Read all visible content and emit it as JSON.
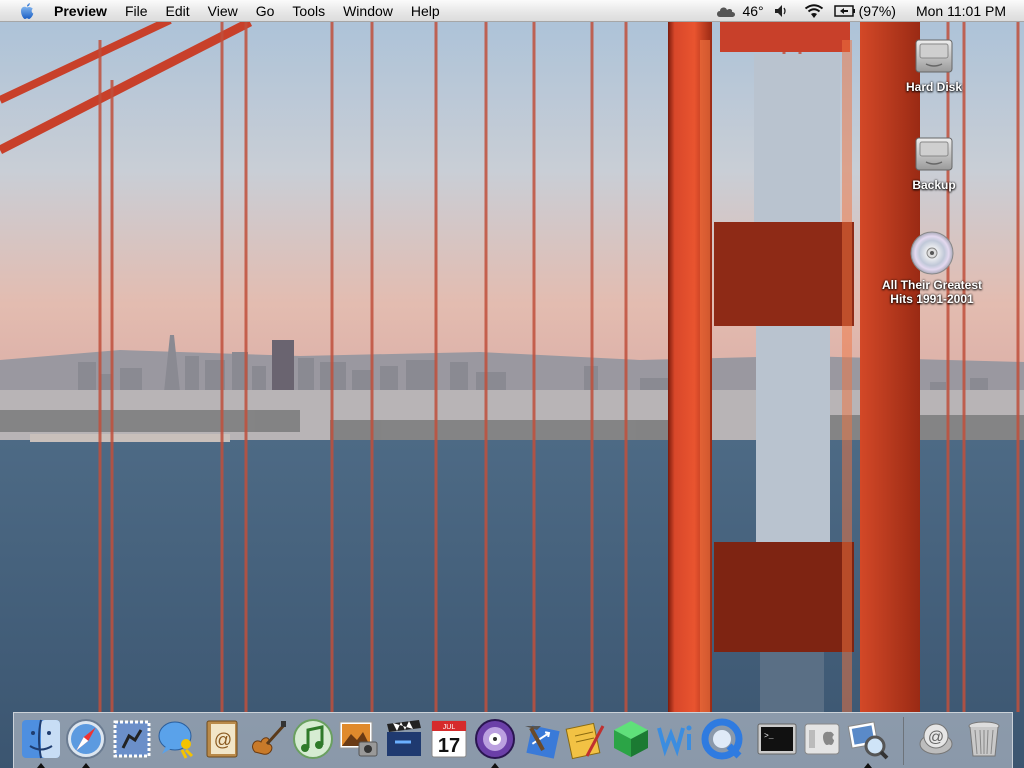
{
  "menubar": {
    "apple_icon": "apple-icon",
    "app_name": "Preview",
    "menus": [
      "File",
      "Edit",
      "View",
      "Go",
      "Tools",
      "Window",
      "Help"
    ],
    "weather": "46°",
    "battery": "(97%)",
    "clock": "Mon 11:01 PM"
  },
  "desktop": {
    "icons": [
      {
        "label": "Hard Disk",
        "icon": "hard-disk-icon"
      },
      {
        "label": "Backup",
        "icon": "hard-disk-icon"
      },
      {
        "label_line1": "All Their Greatest",
        "label_line2": "Hits 1991-2001",
        "icon": "cd-icon"
      }
    ]
  },
  "dock": {
    "items": [
      {
        "name": "Finder",
        "icon": "finder-icon",
        "running": true
      },
      {
        "name": "Safari",
        "icon": "safari-icon",
        "running": true
      },
      {
        "name": "Mail",
        "icon": "mail-icon",
        "running": false
      },
      {
        "name": "iChat",
        "icon": "ichat-icon",
        "running": false
      },
      {
        "name": "Address Book",
        "icon": "address-book-icon",
        "running": false
      },
      {
        "name": "GarageBand",
        "icon": "garageband-icon",
        "running": false
      },
      {
        "name": "iTunes",
        "icon": "itunes-icon",
        "running": false
      },
      {
        "name": "iPhoto",
        "icon": "iphoto-icon",
        "running": false
      },
      {
        "name": "iMovie",
        "icon": "imovie-icon",
        "running": false
      },
      {
        "name": "iCal",
        "icon": "ical-icon",
        "running": false,
        "date_number": "17",
        "month": "JUL"
      },
      {
        "name": "DVD Player",
        "icon": "dvd-player-icon",
        "running": true
      },
      {
        "name": "Xcode",
        "icon": "xcode-icon",
        "running": false
      },
      {
        "name": "Text Editor",
        "icon": "text-editor-icon",
        "running": false
      },
      {
        "name": "Green Cube",
        "icon": "green-cube-icon",
        "running": false
      },
      {
        "name": "Wi",
        "icon": "wi-icon",
        "running": false
      },
      {
        "name": "QuickTime",
        "icon": "quicktime-icon",
        "running": false
      },
      {
        "name": "Terminal",
        "icon": "terminal-icon",
        "running": false
      },
      {
        "name": "System Profiler",
        "icon": "system-profiler-icon",
        "running": false
      },
      {
        "name": "Preview",
        "icon": "preview-icon",
        "running": true
      },
      {
        "name": "Internet Location",
        "icon": "internet-location-icon",
        "running": false
      },
      {
        "name": "Trash",
        "icon": "trash-icon",
        "running": false
      }
    ]
  }
}
